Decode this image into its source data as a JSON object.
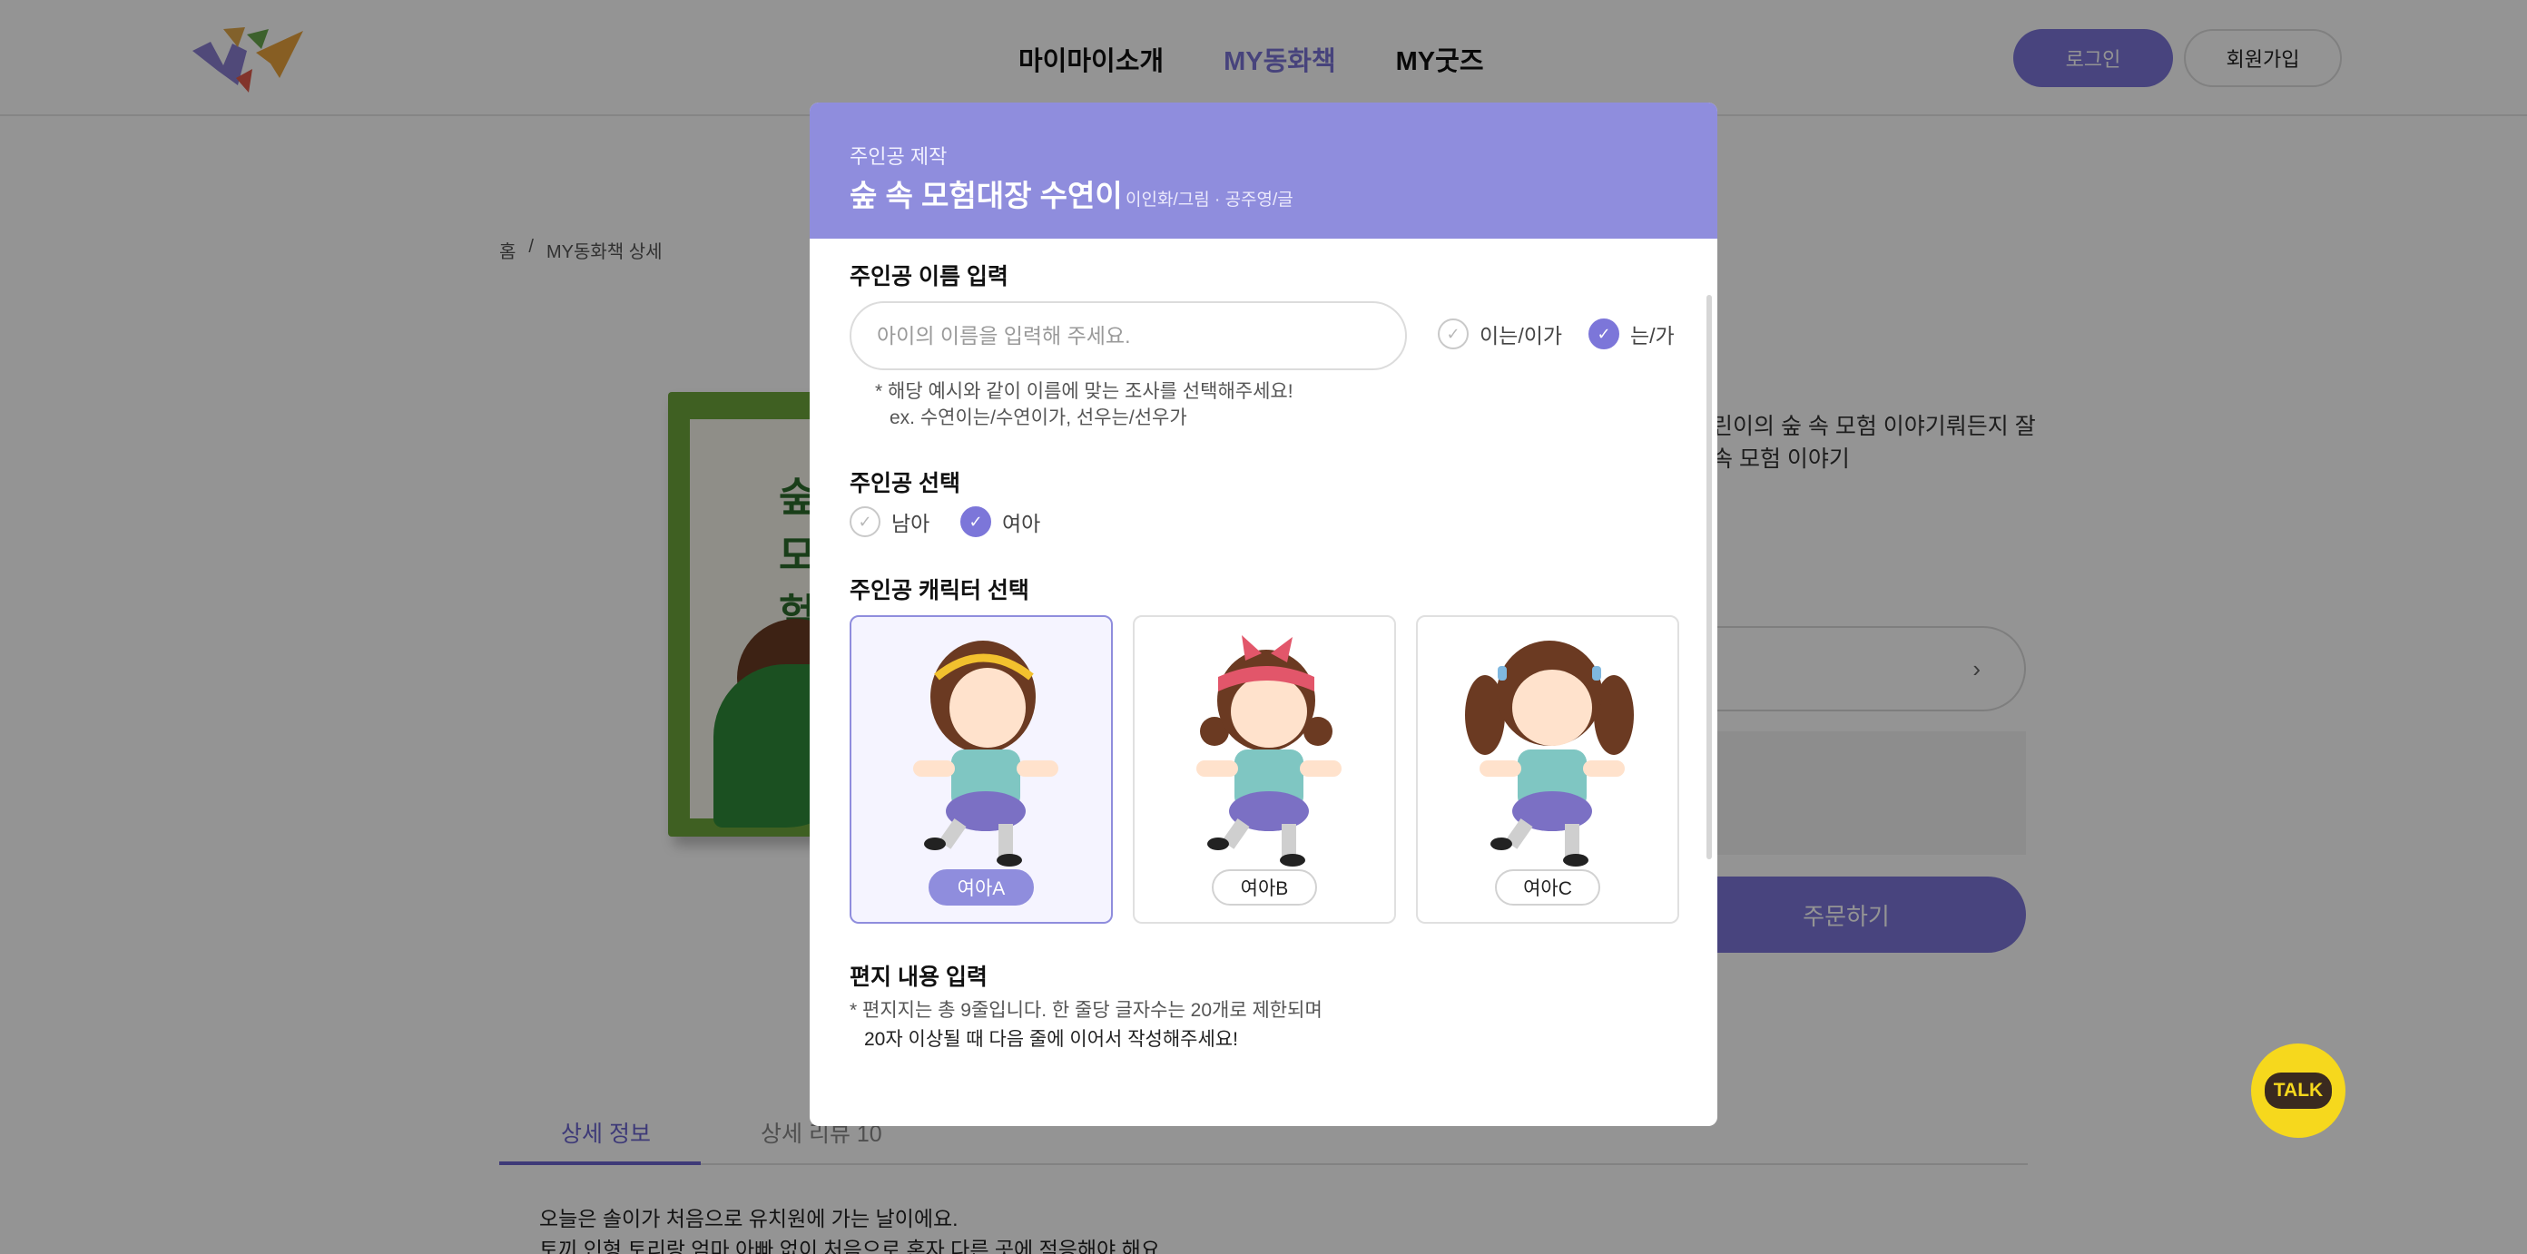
{
  "header": {
    "nav": [
      "마이마이소개",
      "MY동화책",
      "MY굿즈"
    ],
    "active_nav": "MY동화책",
    "login": "로그인",
    "join": "회원가입"
  },
  "breadcrumb": [
    "홈",
    "/",
    "MY동화책 상세"
  ],
  "product": {
    "desc_line1": "린이의 숲 속 모험 이야기뤄든지 잘",
    "desc_line2": "속 모험 이야기",
    "order_button": "주문하기"
  },
  "tabs": [
    "상세 정보",
    "상세 리뷰 10"
  ],
  "body_text": [
    "오늘은 솔이가 처음으로 유치원에 가는 날이에요.",
    "토끼 인형 토리랑 엄마 아빠 없이 처음으로 혼자 다른 곳에 적응해야 해요."
  ],
  "talk_label": "TALK",
  "modal": {
    "subtitle": "주인공 제작",
    "title": "숲 속 모험대장 수연이",
    "author": "이인화/그림 · 공주영/글",
    "name_section": {
      "title": "주인공 이름 입력",
      "placeholder": "아이의 이름을 입력해 주세요.",
      "particle_options": [
        {
          "label": "이는/이가",
          "checked": false
        },
        {
          "label": "는/가",
          "checked": true
        }
      ],
      "hint_1": "* 해당 예시와 같이 이름에 맞는 조사를 선택해주세요!",
      "hint_2": "ex. 수연이는/수연이가, 선우는/선우가"
    },
    "gender_section": {
      "title": "주인공 선택",
      "options": [
        {
          "label": "남아",
          "checked": false
        },
        {
          "label": "여아",
          "checked": true
        }
      ]
    },
    "character_section": {
      "title": "주인공 캐릭터 선택",
      "characters": [
        {
          "label": "여아A",
          "selected": true,
          "icon": "girl-headband-icon"
        },
        {
          "label": "여아B",
          "selected": false,
          "icon": "girl-bow-icon"
        },
        {
          "label": "여아C",
          "selected": false,
          "icon": "girl-pigtails-icon"
        }
      ]
    },
    "letter_section": {
      "title": "편지 내용 입력",
      "hint_1": "* 편지지는 총 9줄입니다. 한 줄당 글자수는 20개로 제한되며",
      "hint_2": "20자 이상될 때 다음 줄에 이어서 작성해주세요!"
    }
  },
  "colors": {
    "accent": "#7c76d9",
    "modal_header": "#8f8ddd",
    "talk": "#f6d81d"
  }
}
